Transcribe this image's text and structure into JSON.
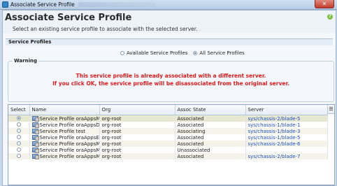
{
  "window": {
    "title": "Associate Service Profile",
    "close_glyph": "✕"
  },
  "header": {
    "title": "Associate Service Profile",
    "subtitle": "Select an existing service profile to associate with the selected server."
  },
  "section": {
    "label": "Service Profiles"
  },
  "filter": {
    "options": [
      {
        "label": "Available Service Profiles",
        "selected": false
      },
      {
        "label": "All Service Profiles",
        "selected": true
      }
    ]
  },
  "warning": {
    "label": "Warning",
    "line1": "This service profile is already associated with a different server.",
    "line2": "If you click OK, the service profile will be disassociated from the original server."
  },
  "table": {
    "columns": [
      "Select",
      "Name",
      "Org",
      "Assoc State",
      "Server"
    ],
    "rows": [
      {
        "selected": true,
        "name": "Service Profile oraAppsMT1",
        "org": "org-root",
        "state": "Associated",
        "server": "sys/chassis-2/blade-5"
      },
      {
        "selected": false,
        "name": "Service Profile oraAppsDB1",
        "org": "org-root",
        "state": "Associated",
        "server": "sys/chassis-1/blade-1"
      },
      {
        "selected": false,
        "name": "Service Profile test",
        "org": "org-root",
        "state": "Associating",
        "server": "sys/chassis-1/blade-3"
      },
      {
        "selected": false,
        "name": "Service Profile oraAppsEM1",
        "org": "org-root",
        "state": "Associated",
        "server": "sys/chassis-1/blade-5"
      },
      {
        "selected": false,
        "name": "Service Profile oraAppsMT2",
        "org": "org-root",
        "state": "Associated",
        "server": "sys/chassis-2/blade-6"
      },
      {
        "selected": false,
        "name": "Service Profile oraAppsMT4",
        "org": "org-root",
        "state": "Unassociated",
        "server": ""
      },
      {
        "selected": false,
        "name": "Service Profile oraAppsMT3",
        "org": "org-root",
        "state": "Associated",
        "server": "sys/chassis-2/blade-7"
      }
    ]
  },
  "colors": {
    "warning_text": "#e01b1b",
    "link": "#1a4fbf",
    "window_bg": "#c9d9ea"
  }
}
